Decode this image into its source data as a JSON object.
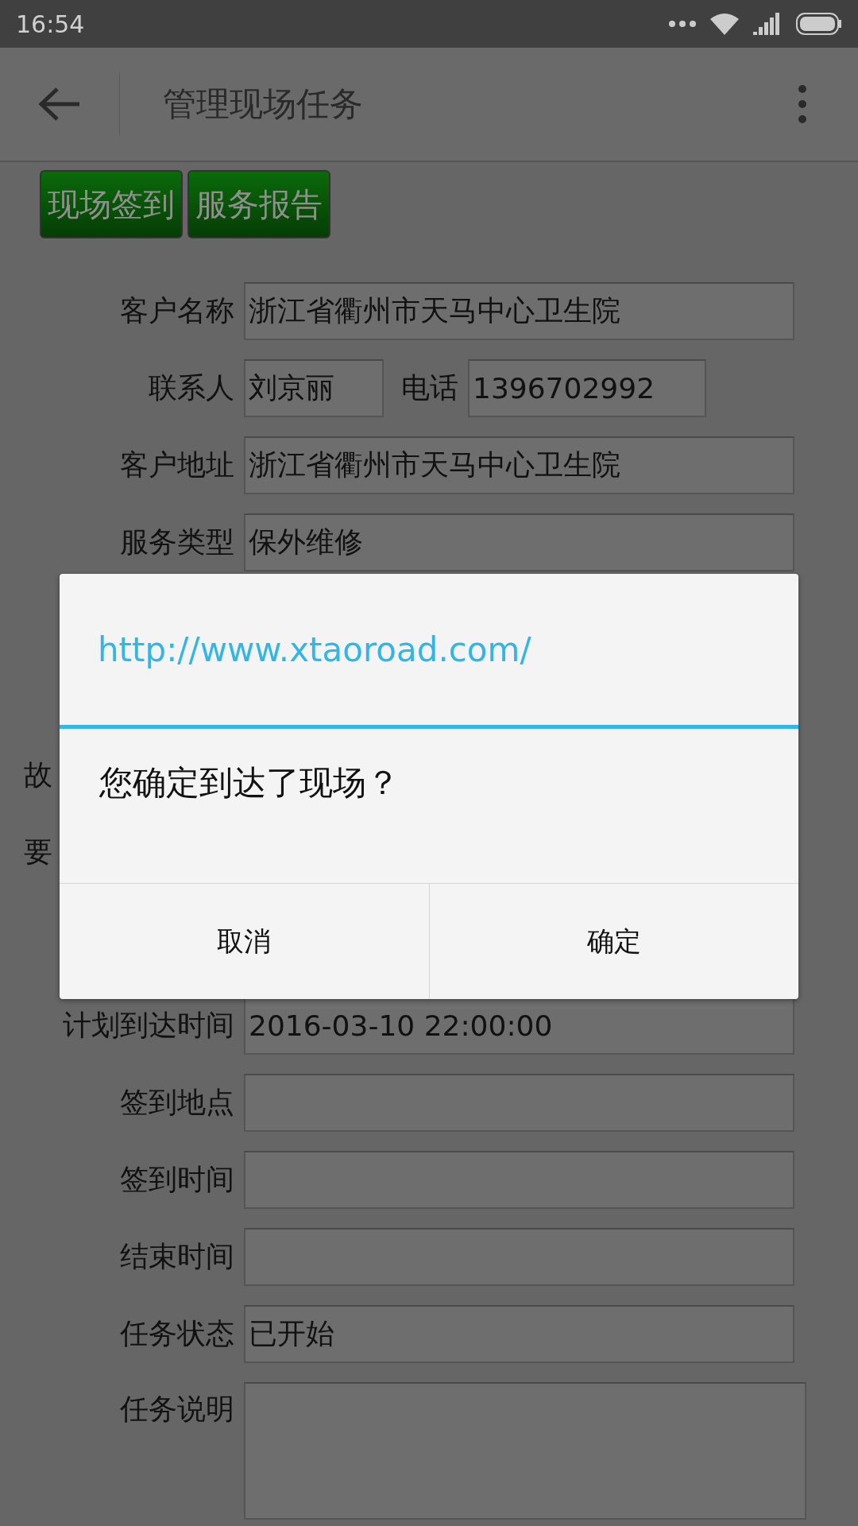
{
  "status_bar": {
    "time": "16:54"
  },
  "app_bar": {
    "title": "管理现场任务"
  },
  "action_buttons": [
    "现场签到",
    "服务报告"
  ],
  "form_top": [
    {
      "kind": "single",
      "label": "客户名称",
      "value": "浙江省衢州市天马中心卫生院"
    },
    {
      "kind": "pair",
      "label": "联系人",
      "value": "刘京丽",
      "label_2": "电话",
      "value_2": "1396702992"
    },
    {
      "kind": "single",
      "label": "客户地址",
      "value": "浙江省衢州市天马中心卫生院"
    },
    {
      "kind": "single",
      "label": "服务类型",
      "value": "保外维修"
    }
  ],
  "form_hidden_labels": [
    "故",
    "要"
  ],
  "form_bottom": [
    {
      "kind": "single",
      "label": "计划到达时间",
      "value": "2016-03-10 22:00:00"
    },
    {
      "kind": "single",
      "label": "签到地点"
    },
    {
      "kind": "single",
      "label": "签到时间"
    },
    {
      "kind": "single",
      "label": "结束时间"
    },
    {
      "kind": "single",
      "label": "任务状态",
      "value": "已开始"
    },
    {
      "kind": "area",
      "label": "任务说明"
    }
  ],
  "dialog": {
    "title": "http://www.xtaoroad.com/",
    "message": "您确定到达了现场？",
    "buttons": [
      "取消",
      "确定"
    ]
  }
}
